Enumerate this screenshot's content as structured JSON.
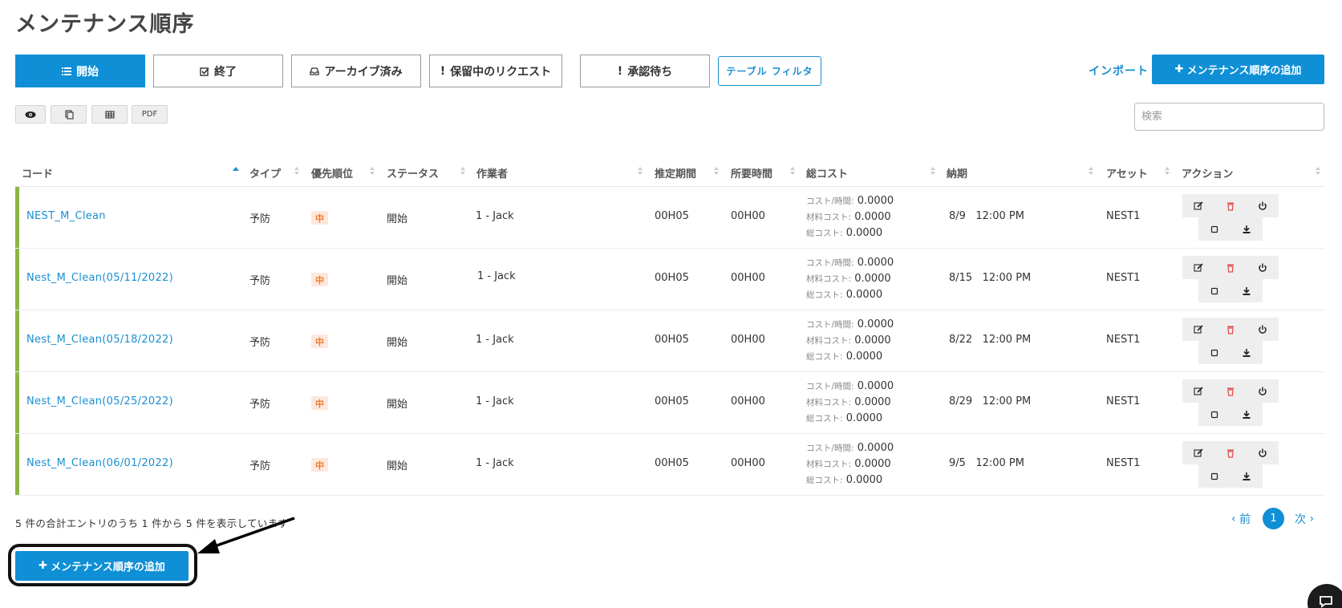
{
  "page": {
    "title": "メンテナンス順序"
  },
  "tabs": [
    {
      "label": "開始",
      "icon": "list-icon"
    },
    {
      "label": "終了",
      "icon": "check-square-icon"
    },
    {
      "label": "アーカイブ済み",
      "icon": "inbox-icon"
    },
    {
      "label": "保留中のリクエスト",
      "icon": "exclamation-icon"
    },
    {
      "label": "承認待ち",
      "icon": "exclamation-icon"
    }
  ],
  "filter_button": "テーブル フィルタ",
  "import_link": "インポート",
  "add_button": "メンテナンス順序の追加",
  "toolbar": {
    "pdf_label": "PDF"
  },
  "search": {
    "placeholder": "検索",
    "value": ""
  },
  "columns": [
    "コード",
    "タイプ",
    "優先順位",
    "ステータス",
    "作業者",
    "推定期間",
    "所要時間",
    "総コスト",
    "納期",
    "アセット",
    "アクション"
  ],
  "cost_labels": {
    "per_hour": "コスト/時間:",
    "material": "材料コスト:",
    "total": "総コスト:"
  },
  "rows": [
    {
      "code": "NEST_M_Clean",
      "type": "予防",
      "priority": "中",
      "status": "開始",
      "worker": "1 - Jack",
      "estimated": "00H05",
      "elapsed": "00H00",
      "cost_per_hour": "0.0000",
      "material_cost": "0.0000",
      "total_cost": "0.0000",
      "due_date": "8/9",
      "due_time": "12:00 PM",
      "asset": "NEST1"
    },
    {
      "code": "Nest_M_Clean(05/11/2022)",
      "type": "予防",
      "priority": "中",
      "status": "開始",
      "worker": "1 - Jack",
      "estimated": "00H05",
      "elapsed": "00H00",
      "cost_per_hour": "0.0000",
      "material_cost": "0.0000",
      "total_cost": "0.0000",
      "due_date": "8/15",
      "due_time": "12:00 PM",
      "asset": "NEST1"
    },
    {
      "code": "Nest_M_Clean(05/18/2022)",
      "type": "予防",
      "priority": "中",
      "status": "開始",
      "worker": "1 - Jack",
      "estimated": "00H05",
      "elapsed": "00H00",
      "cost_per_hour": "0.0000",
      "material_cost": "0.0000",
      "total_cost": "0.0000",
      "due_date": "8/22",
      "due_time": "12:00 PM",
      "asset": "NEST1"
    },
    {
      "code": "Nest_M_Clean(05/25/2022)",
      "type": "予防",
      "priority": "中",
      "status": "開始",
      "worker": "1 - Jack",
      "estimated": "00H05",
      "elapsed": "00H00",
      "cost_per_hour": "0.0000",
      "material_cost": "0.0000",
      "total_cost": "0.0000",
      "due_date": "8/29",
      "due_time": "12:00 PM",
      "asset": "NEST1"
    },
    {
      "code": "Nest_M_Clean(06/01/2022)",
      "type": "予防",
      "priority": "中",
      "status": "開始",
      "worker": "1 - Jack",
      "estimated": "00H05",
      "elapsed": "00H00",
      "cost_per_hour": "0.0000",
      "material_cost": "0.0000",
      "total_cost": "0.0000",
      "due_date": "9/5",
      "due_time": "12:00 PM",
      "asset": "NEST1"
    }
  ],
  "summary": "5 件の合計エントリのうち 1 件から 5 件を表示しています",
  "pagination": {
    "prev": "前",
    "current": "1",
    "next": "次"
  },
  "colors": {
    "accent": "#0e8fd6",
    "row_bar": "#8db544",
    "priority_bg": "#fde8dd",
    "priority_text": "#f07a2e",
    "delete_icon": "#e04848"
  }
}
